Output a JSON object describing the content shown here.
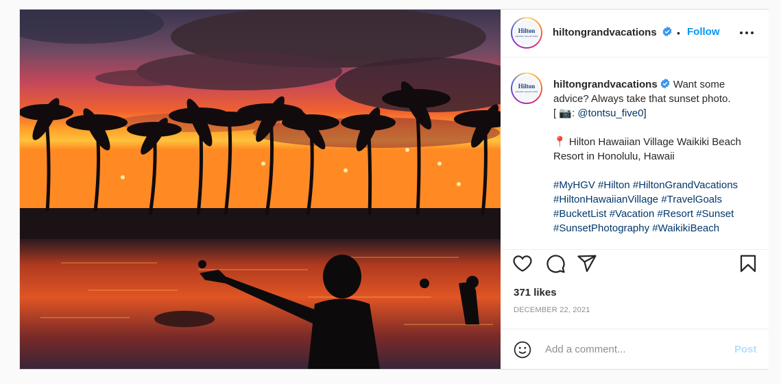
{
  "header": {
    "username": "hiltongrandvacations",
    "dot": "•",
    "follow_label": "Follow",
    "avatar_logo": "Hilton",
    "avatar_sub": "GRAND VACATIONS"
  },
  "caption": {
    "username": "hiltongrandvacations",
    "text": "Want some advice? Always take that sunset photo.",
    "credit_prefix": "[ 📷: ",
    "credit_handle": "@tontsu_five0",
    "credit_suffix": "]",
    "location_pin": "📍",
    "location": "Hilton Hawaiian Village Waikiki Beach Resort in Honolulu, Hawaii",
    "hashtags": [
      "#MyHGV",
      "#Hilton",
      "#HiltonGrandVacations",
      "#HiltonHawaiianVillage",
      "#TravelGoals",
      "#BucketList",
      "#Vacation",
      "#Resort",
      "#Sunset",
      "#SunsetPhotography",
      "#WaikikiBeach"
    ]
  },
  "engagement": {
    "likes": "371 likes",
    "date": "DECEMBER 22, 2021"
  },
  "comment": {
    "placeholder": "Add a comment...",
    "post_label": "Post"
  },
  "icons": {
    "like": "heart-icon",
    "comment": "comment-icon",
    "share": "paper-plane-icon",
    "save": "bookmark-icon",
    "emoji": "smiley-icon",
    "more": "more-options-icon",
    "verified": "verified-badge-icon"
  },
  "colors": {
    "follow": "#0095f6",
    "verified": "#3897f0",
    "hashtag": "#00376b",
    "post_disabled": "#b2dffc"
  }
}
